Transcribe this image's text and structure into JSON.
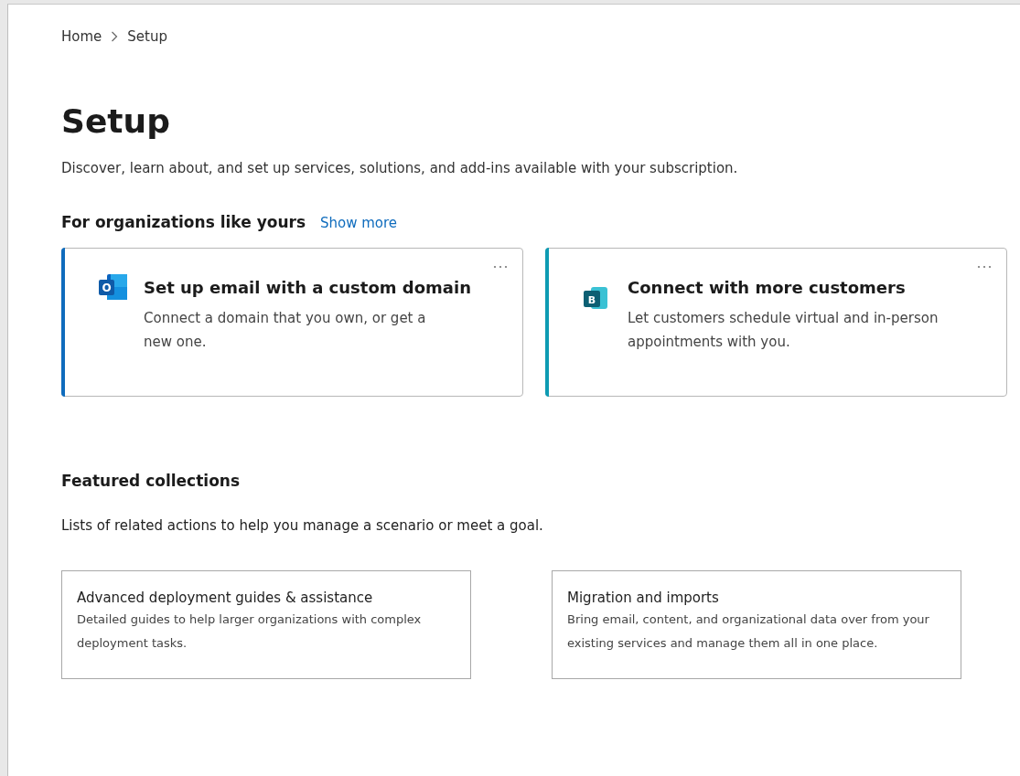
{
  "breadcrumb": [
    {
      "label": "Home"
    },
    {
      "label": "Setup"
    }
  ],
  "title": "Setup",
  "description": "Discover, learn about, and set up services, solutions, and add-ins available with your subscription.",
  "recommended": {
    "heading": "For organizations like yours",
    "link": "Show more",
    "cards": [
      {
        "kind": "mail",
        "icon_letter": "O",
        "color": "#0f6cbd",
        "title": "Set up email with a custom domain",
        "text": "Connect a domain that you own, or get a new one."
      },
      {
        "kind": "bookings",
        "icon_letter": "B",
        "color": "#0e9bb3",
        "title": "Connect with more customers",
        "text": "Let customers schedule virtual and in-person appointments with you."
      }
    ]
  },
  "featured": {
    "heading": "Featured collections",
    "description": "Lists of related actions to help you manage a scenario or meet a goal.",
    "cards": [
      {
        "title": "Advanced deployment guides & assistance",
        "text": "Detailed guides to help larger organizations with complex deployment tasks."
      },
      {
        "title": "Migration and imports",
        "text": "Bring email, content, and organizational data over from your existing services and manage them all in one place."
      }
    ]
  }
}
